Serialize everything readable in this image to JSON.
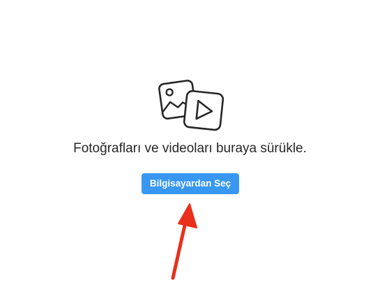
{
  "upload": {
    "icon": "photo-video-icon",
    "prompt": "Fotoğrafları ve videoları buraya sürükle.",
    "button_label": "Bilgisayardan Seç"
  },
  "annotation": {
    "icon": "red-arrow-up-icon",
    "color": "#e8301c"
  },
  "colors": {
    "accent": "#3897f0",
    "text": "#262626",
    "icon_stroke": "#262626"
  }
}
